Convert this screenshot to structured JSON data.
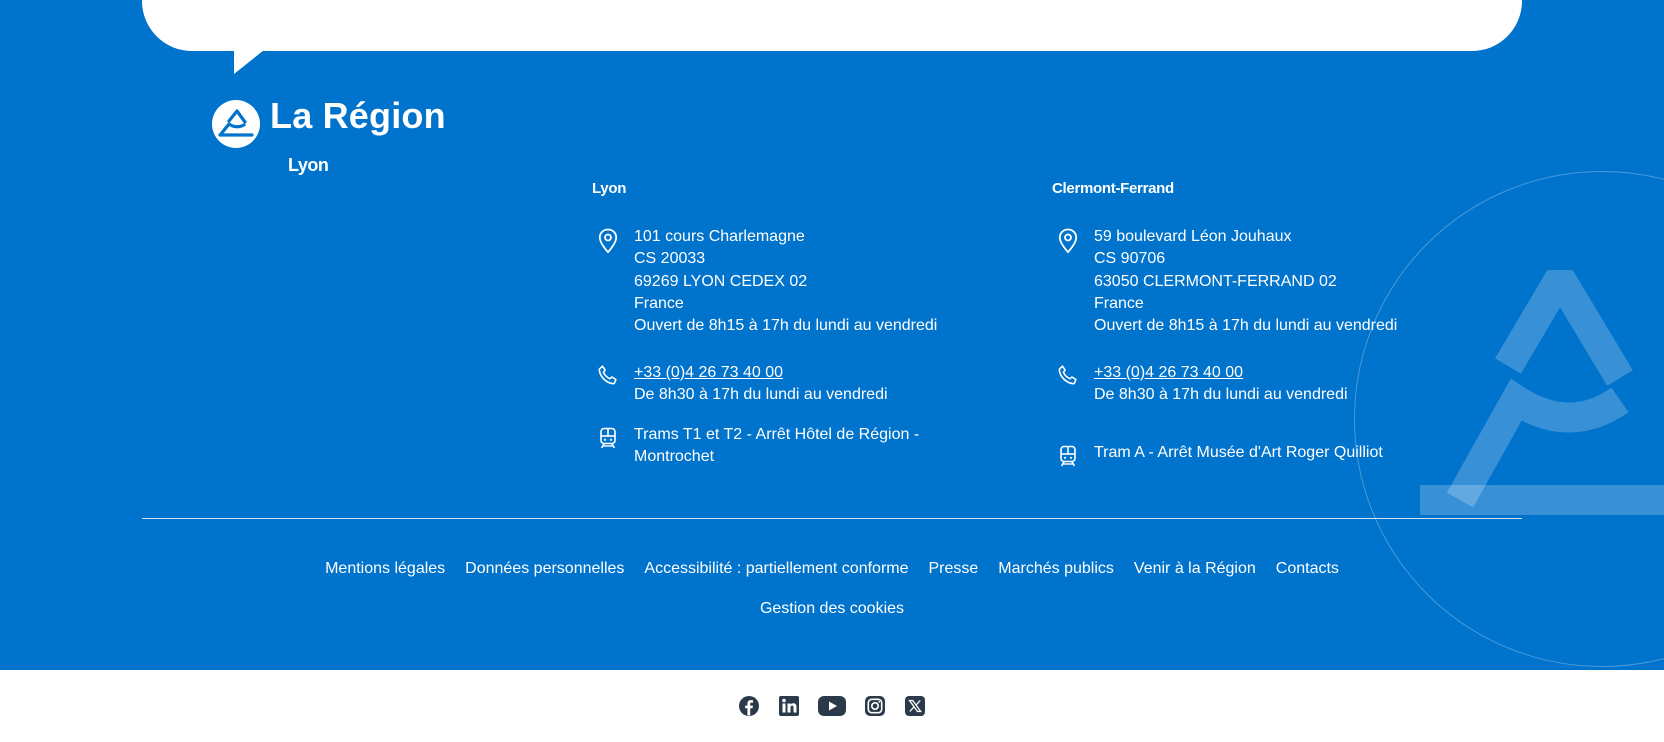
{
  "logo": {
    "name": "La Région",
    "subtitle": "Lyon"
  },
  "offices": [
    {
      "city": "Lyon",
      "address": [
        "101 cours Charlemagne",
        "CS 20033",
        "69269 LYON CEDEX 02",
        "France",
        "Ouvert de 8h15 à 17h du lundi au vendredi"
      ],
      "phone": "+33 (0)4 26 73 40 00",
      "phone_hours": "De 8h30 à 17h du lundi au vendredi",
      "transport": [
        "Trams T1 et T2 - Arrêt Hôtel de Région -",
        "Montrochet"
      ]
    },
    {
      "city": "Clermont-Ferrand",
      "address": [
        "59 boulevard Léon Jouhaux",
        "CS 90706",
        "63050 CLERMONT-FERRAND 02",
        "France",
        "Ouvert de 8h15 à 17h du lundi au vendredi"
      ],
      "phone": "+33 (0)4 26 73 40 00",
      "phone_hours": "De 8h30 à 17h du lundi au vendredi",
      "transport": [
        "Tram A - Arrêt Musée d'Art Roger Quilliot"
      ]
    }
  ],
  "footer_links": [
    "Mentions légales",
    "Données personnelles",
    "Accessibilité : partiellement conforme",
    "Presse",
    "Marchés publics",
    "Venir à la Région",
    "Contacts"
  ],
  "footer_links_row2": [
    "Gestion des cookies"
  ],
  "social": [
    "facebook-icon",
    "linkedin-icon",
    "youtube-icon",
    "instagram-icon",
    "x-icon"
  ],
  "colors": {
    "brand_blue": "#0073cc",
    "icon_dark": "#2b3a4a"
  }
}
